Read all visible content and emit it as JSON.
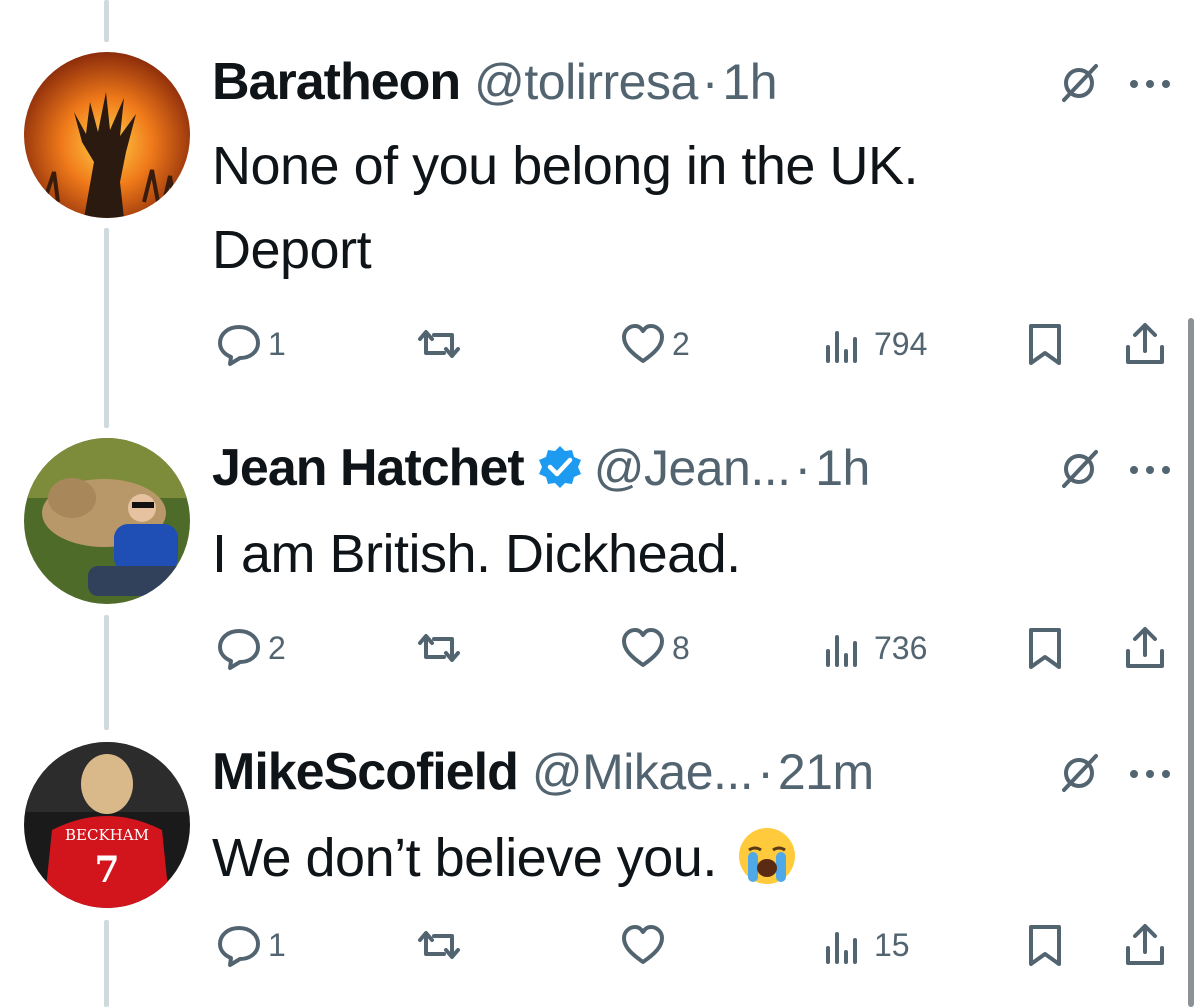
{
  "tweets": [
    {
      "name": "Baratheon",
      "verified": false,
      "handle": "@tolirresa",
      "dot": "·",
      "time": "1h",
      "text_lines": [
        "None of you belong in the UK.",
        "Deport"
      ],
      "replies": "1",
      "retweets": "",
      "likes": "2",
      "views": "794"
    },
    {
      "name": "Jean Hatchet",
      "verified": true,
      "handle": "@Jean...",
      "dot": "·",
      "time": "1h",
      "text_lines": [
        "I am British. Dickhead."
      ],
      "replies": "2",
      "retweets": "",
      "likes": "8",
      "views": "736"
    },
    {
      "name": "MikeScofield",
      "verified": false,
      "handle": "@Mikae...",
      "dot": "·",
      "time": "21m",
      "text_lines": [
        "We don’t believe you."
      ],
      "text_emoji": "loudly-crying-face",
      "avatar_jersey_text": "BECKHAM",
      "avatar_jersey_number": "7",
      "replies": "1",
      "retweets": "",
      "likes": "",
      "views": "15"
    }
  ],
  "colors": {
    "text": "#0f1419",
    "secondary": "#536471",
    "verified": "#1d9bf0",
    "thread_line": "#cfd9de"
  },
  "icons": {
    "reply": "speech-bubble-icon",
    "retweet": "retweet-icon",
    "like": "heart-icon",
    "views": "bar-chart-icon",
    "bookmark": "bookmark-icon",
    "share": "share-icon",
    "grok": "grok-icon",
    "more": "more-icon"
  }
}
